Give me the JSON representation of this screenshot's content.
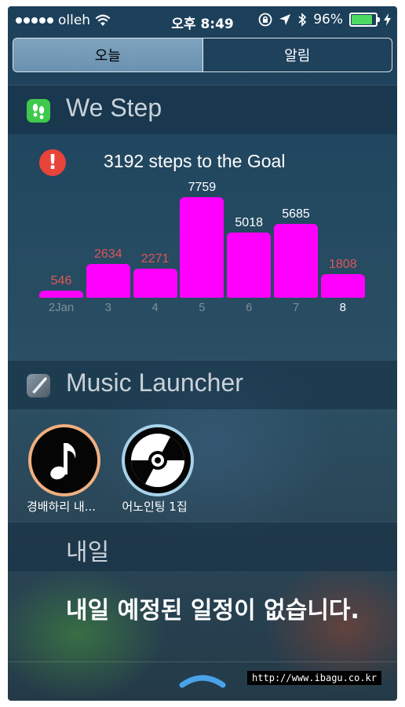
{
  "status_bar": {
    "carrier": "olleh",
    "time": "오후 8:49",
    "battery": "96%",
    "battery_level": 0.96
  },
  "segment": {
    "today": "오늘",
    "notifications": "알림",
    "selected": "오늘"
  },
  "we_step": {
    "title": "We Step",
    "goal_text": "3192 steps to the Goal",
    "alert_glyph": "!"
  },
  "chart_data": {
    "type": "bar",
    "categories": [
      "2Jan",
      "3",
      "4",
      "5",
      "6",
      "7",
      "8"
    ],
    "values": [
      546,
      2634,
      2271,
      7759,
      5018,
      5685,
      1808
    ],
    "value_colors": [
      "#e05555",
      "#e05555",
      "#e05555",
      "#ffffff",
      "#ffffff",
      "#ffffff",
      "#e05555"
    ],
    "bar_color": "#ff00ff",
    "ylim": [
      0,
      7759
    ]
  },
  "music_launcher": {
    "title": "Music Launcher",
    "items": [
      {
        "label": "경배하리 내...",
        "icon": "music-note-icon"
      },
      {
        "label": "어노인팅 1집",
        "icon": "cd-icon"
      }
    ]
  },
  "tomorrow": {
    "title": "내일",
    "message": "내일 예정된 일정이 없습니다."
  },
  "watermark": "http://www.ibagu.co.kr"
}
